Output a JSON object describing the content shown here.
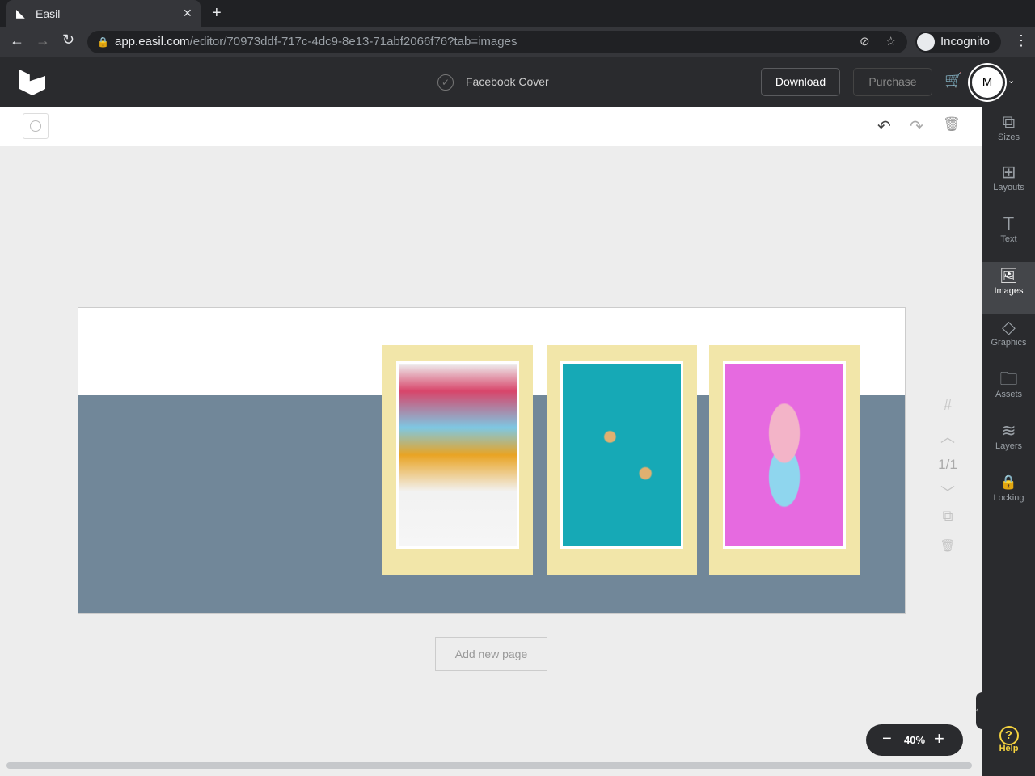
{
  "browser": {
    "tab_title": "Easil",
    "url_host": "app.easil.com",
    "url_path": "/editor/70973ddf-717c-4dc9-8e13-71abf2066f76?tab=images",
    "profile": "Incognito"
  },
  "header": {
    "design_title": "Facebook Cover",
    "download": "Download",
    "purchase": "Purchase",
    "avatar": "M"
  },
  "sidebar": {
    "items": [
      {
        "label": "Sizes",
        "icon": "⧉"
      },
      {
        "label": "Layouts",
        "icon": "⊞"
      },
      {
        "label": "Text",
        "icon": "T"
      },
      {
        "label": "Images",
        "icon": "🖼"
      },
      {
        "label": "Graphics",
        "icon": "◇"
      },
      {
        "label": "Assets",
        "icon": "🗀"
      },
      {
        "label": "Layers",
        "icon": "≋"
      },
      {
        "label": "Locking",
        "icon": "🔒"
      }
    ],
    "help": "Help"
  },
  "canvas": {
    "page_indicator": "1/1",
    "add_page": "Add new page",
    "zoom": "40%"
  },
  "colors": {
    "band": "#718799",
    "card": "#f2e6a9",
    "accent": "#f5d33f"
  }
}
